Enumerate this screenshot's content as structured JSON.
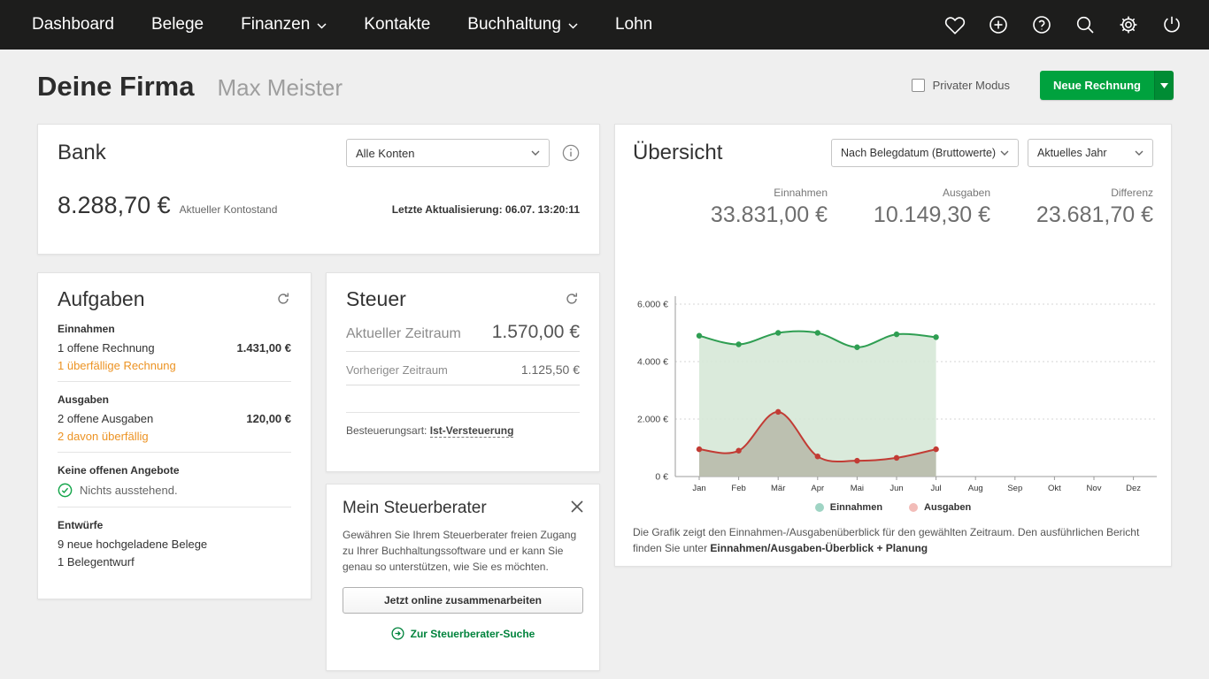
{
  "colors": {
    "brand_green": "#00a23e",
    "overdue_orange": "#ec9323",
    "link_green": "#00833c",
    "nav_background": "#1d1d1c"
  },
  "nav": {
    "items": [
      {
        "label": "Dashboard",
        "active": true
      },
      {
        "label": "Belege"
      },
      {
        "label": "Finanzen",
        "has_dropdown": true
      },
      {
        "label": "Kontakte"
      },
      {
        "label": "Buchhaltung",
        "has_dropdown": true
      },
      {
        "label": "Lohn"
      }
    ],
    "icons": [
      "heart",
      "plus-circle",
      "help-circle",
      "search",
      "settings-gear",
      "power"
    ]
  },
  "header": {
    "company": "Deine Firma",
    "user": "Max Meister",
    "private_mode_label": "Privater Modus",
    "new_invoice_label": "Neue Rechnung"
  },
  "bank": {
    "title": "Bank",
    "account_filter": "Alle Konten",
    "balance": "8.288,70 €",
    "balance_label": "Aktueller Kontostand",
    "last_update": "Letzte Aktualisierung: 06.07.  13:20:11"
  },
  "tasks": {
    "title": "Aufgaben",
    "income": {
      "header": "Einnahmen",
      "open": "1  offene Rechnung",
      "amount": "1.431,00 €",
      "overdue": "1  überfällige Rechnung"
    },
    "expenses": {
      "header": "Ausgaben",
      "open": "2  offene Ausgaben",
      "amount": "120,00 €",
      "overdue": "2  davon überfällig"
    },
    "offers": {
      "header": "Keine offenen Angebote",
      "status": "Nichts ausstehend."
    },
    "drafts": {
      "header": "Entwürfe",
      "items": [
        "9  neue hochgeladene Belege",
        "1  Belegentwurf"
      ]
    }
  },
  "tax": {
    "title": "Steuer",
    "current_label": "Aktueller Zeitraum",
    "current_value": "1.570,00 €",
    "previous_label": "Vorheriger Zeitraum",
    "previous_value": "1.125,50 €",
    "taxation_label": "Besteuerungsart:",
    "taxation_value": "Ist-Versteuerung"
  },
  "advisor": {
    "title": "Mein Steuerberater",
    "body": "Gewähren Sie Ihrem Steuerberater freien Zugang zu Ihrer Buchhaltungssoftware und er kann Sie genau so unterstützen, wie Sie es möchten.",
    "cta": "Jetzt online zusammenarbeiten",
    "link": "Zur Steuerberater-Suche"
  },
  "overview": {
    "title": "Übersicht",
    "filter_mode": "Nach Belegdatum (Bruttowerte)",
    "filter_period": "Aktuelles Jahr",
    "stats": [
      {
        "label": "Einnahmen",
        "value": "33.831,00 €"
      },
      {
        "label": "Ausgaben",
        "value": "10.149,30 €"
      },
      {
        "label": "Differenz",
        "value": "23.681,70 €"
      }
    ],
    "footnote_text": "Die Grafik zeigt den Einnahmen-/Ausgabenüberblick für den gewählten Zeitraum. Den ausführlichen Bericht finden Sie unter ",
    "footnote_link": "Einnahmen/Ausgaben-Überblick + Planung"
  },
  "chart_data": {
    "type": "area",
    "title": "Einnahmen / Ausgaben Überblick",
    "x": [
      "Jan",
      "Feb",
      "Mär",
      "Apr",
      "Mai",
      "Jun",
      "Jul",
      "Aug",
      "Sep",
      "Okt",
      "Nov",
      "Dez"
    ],
    "yticks": [
      0,
      2000,
      4000,
      6000
    ],
    "ytick_labels": [
      "0 €",
      "2.000 €",
      "4.000 €",
      "6.000 €"
    ],
    "ylim": [
      0,
      6500
    ],
    "grid": "horizontal-dotted",
    "legend_position": "bottom-center",
    "series": [
      {
        "name": "Einnahmen",
        "color": "#2f9e52",
        "fill": "#d6e8d7",
        "fill_opacity": 0.9,
        "values": [
          4900,
          4600,
          5000,
          5000,
          4500,
          4950,
          4850
        ]
      },
      {
        "name": "Ausgaben",
        "color": "#c23b34",
        "fill": "#a8a492",
        "fill_opacity": 0.6,
        "values": [
          950,
          900,
          2250,
          700,
          550,
          650,
          950
        ]
      }
    ],
    "legend": [
      {
        "label": "Einnahmen",
        "swatch": "#9fd4c4"
      },
      {
        "label": "Ausgaben",
        "swatch": "#f2bcb8"
      }
    ]
  }
}
